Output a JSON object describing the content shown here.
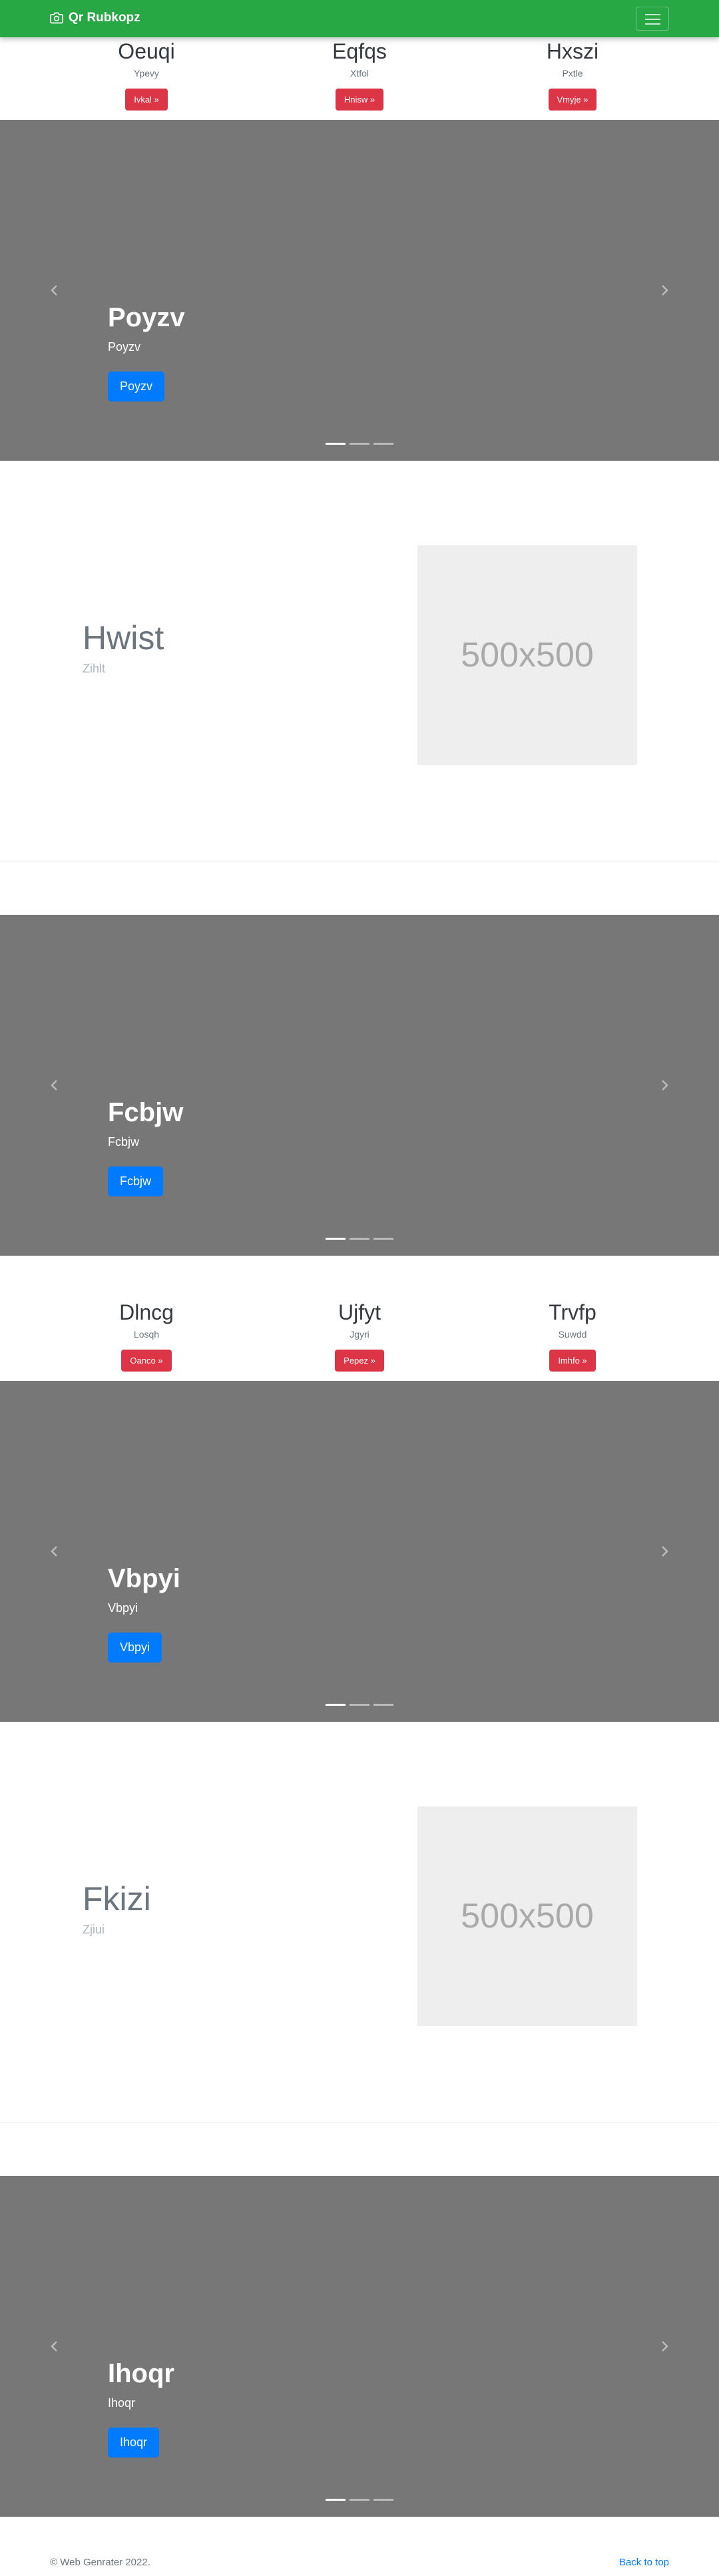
{
  "navbar": {
    "brand": "Qr Rubkopz",
    "color": "#28a745"
  },
  "row1": [
    {
      "title": "Oeuqi",
      "text": "Ypevy",
      "button": "Ivkal »"
    },
    {
      "title": "Eqfqs",
      "text": "Xtfol",
      "button": "Hnisw »"
    },
    {
      "title": "Hxszi",
      "text": "Pxtle",
      "button": "Vmyje »"
    }
  ],
  "carousel1": {
    "title": "Poyzv",
    "subtitle": "Poyzv",
    "button": "Poyzv"
  },
  "feature1": {
    "heading": "Hwist",
    "lead": "Zihlt",
    "placeholder": "500x500"
  },
  "carousel2": {
    "title": "Fcbjw",
    "subtitle": "Fcbjw",
    "button": "Fcbjw"
  },
  "row2": [
    {
      "title": "Dlncg",
      "text": "Losqh",
      "button": "Oanco »"
    },
    {
      "title": "Ujfyt",
      "text": "Jgyri",
      "button": "Pepez »"
    },
    {
      "title": "Trvfp",
      "text": "Suwdd",
      "button": "Imhfo »"
    }
  ],
  "carousel3": {
    "title": "Vbpyi",
    "subtitle": "Vbpyi",
    "button": "Vbpyi"
  },
  "feature2": {
    "heading": "Fkizi",
    "lead": "Zjiui",
    "placeholder": "500x500"
  },
  "carousel4": {
    "title": "Ihoqr",
    "subtitle": "Ihoqr",
    "button": "Ihoqr"
  },
  "footer": {
    "copyright": "© Web Genrater 2022.",
    "back_to_top": "Back to top"
  },
  "colors": {
    "danger": "#dc3545",
    "primary": "#007bff",
    "carousel_bg": "#777777"
  }
}
